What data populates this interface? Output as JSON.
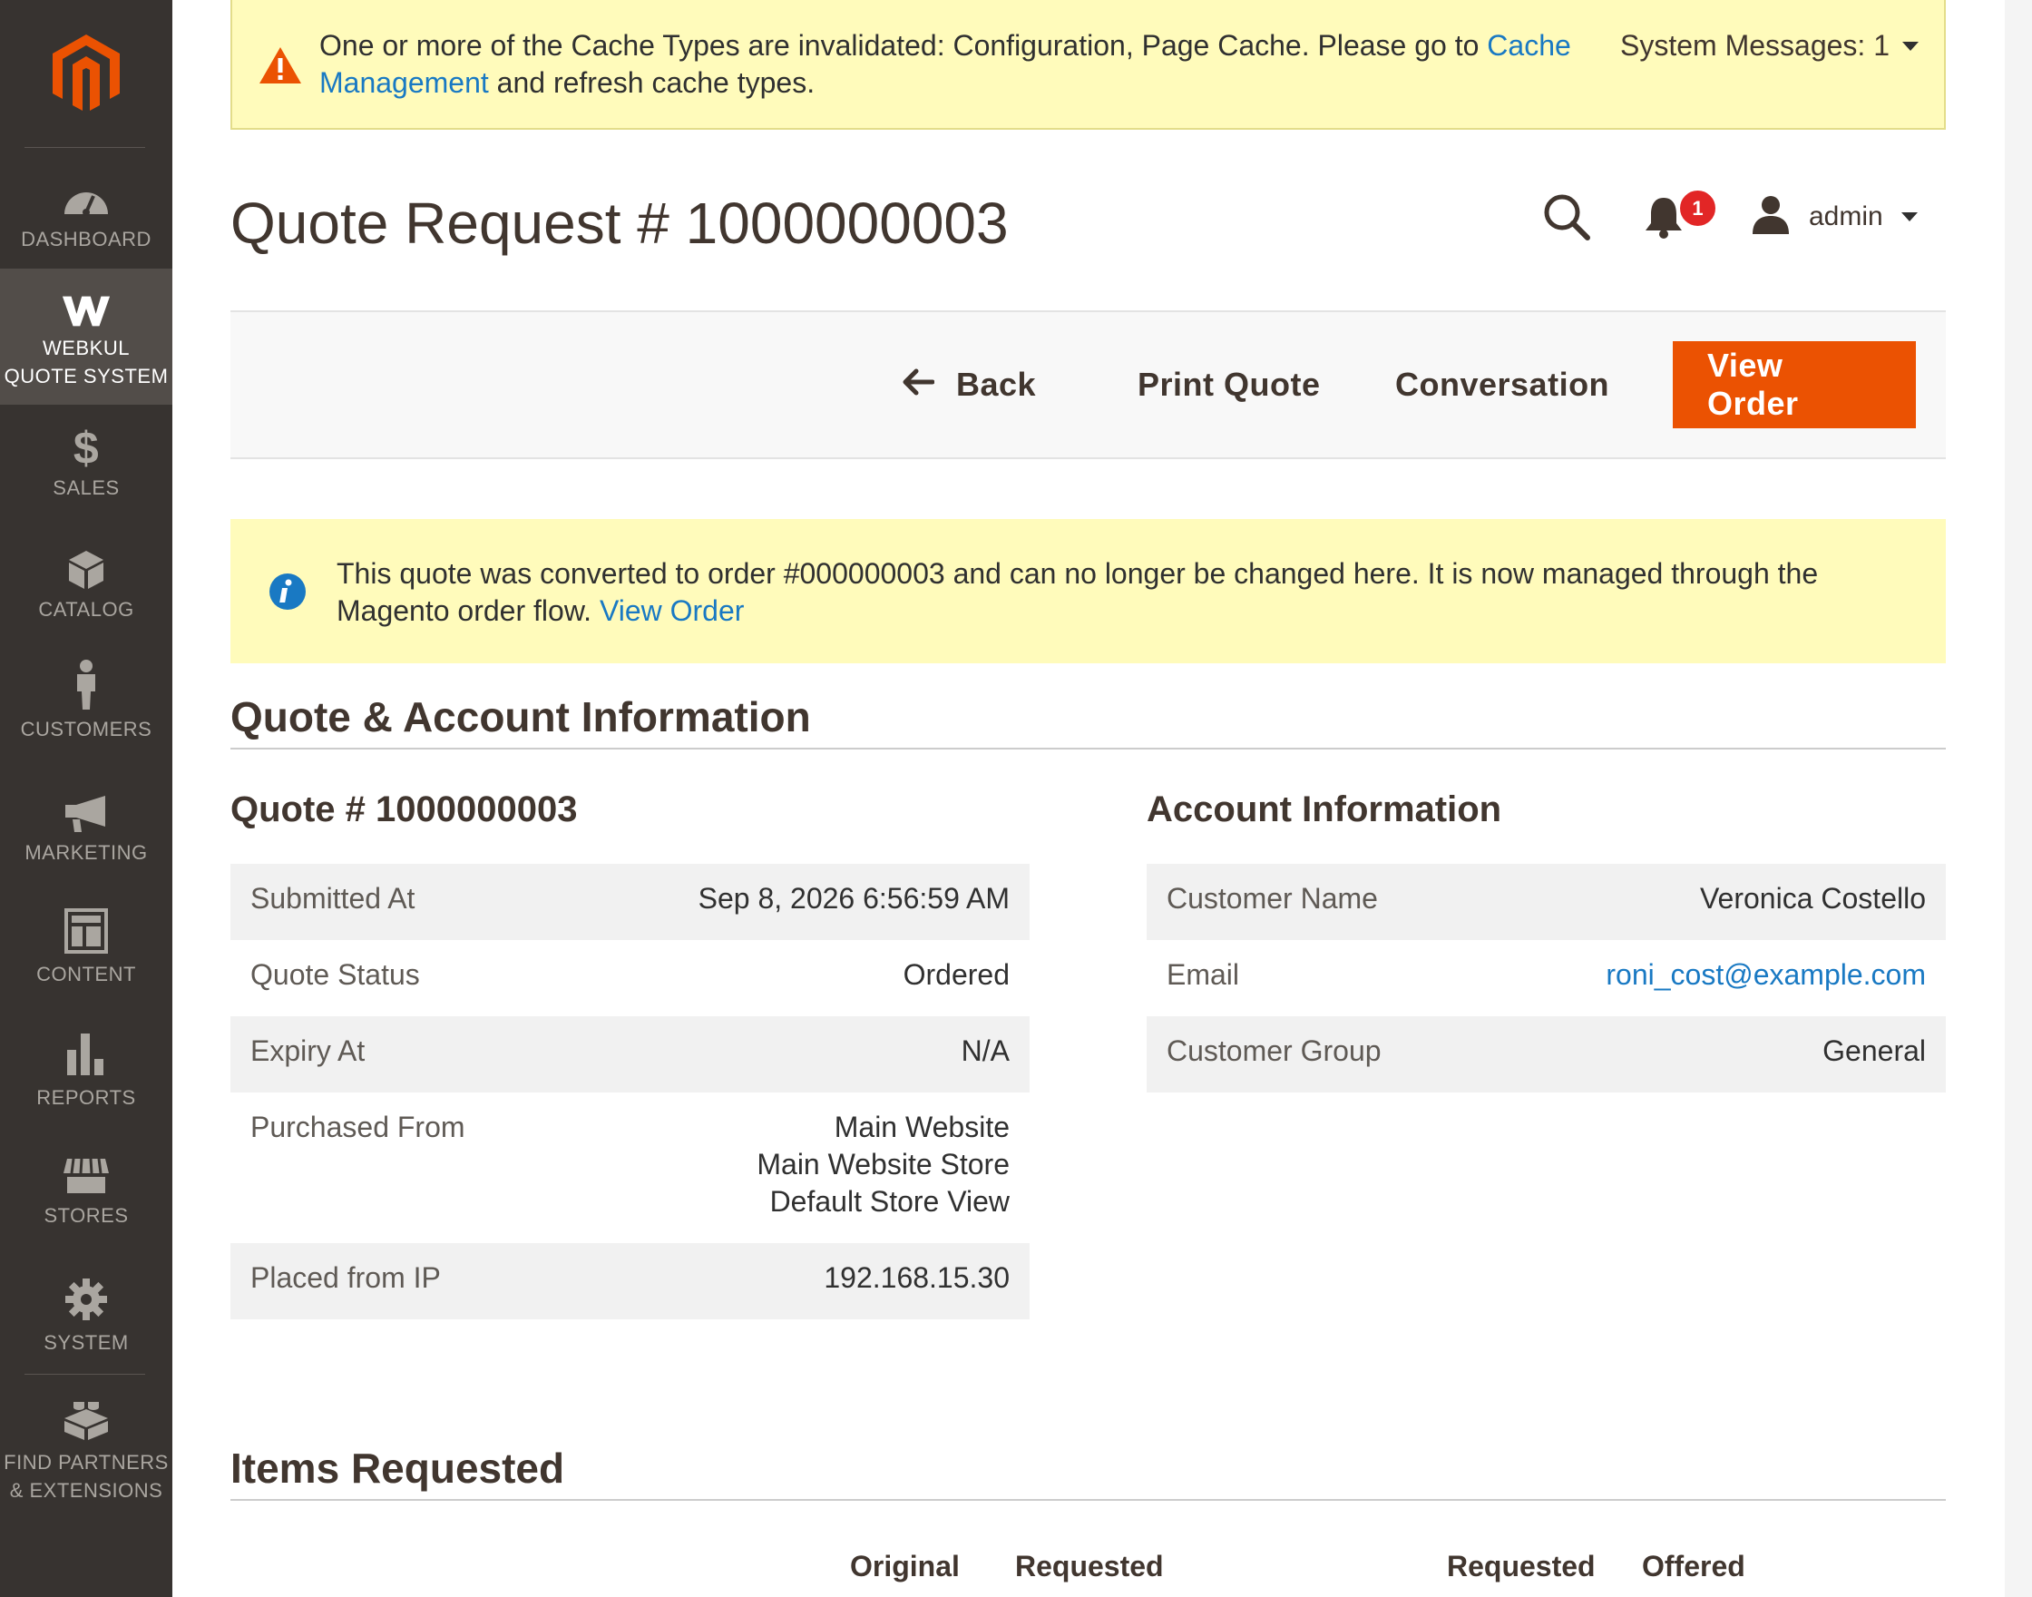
{
  "sidebar": {
    "items": [
      {
        "label": "DASHBOARD",
        "icon": "dashboard-icon"
      },
      {
        "label": "WEBKUL\nQUOTE SYSTEM",
        "icon": "webkul-icon",
        "active": true
      },
      {
        "label": "SALES",
        "icon": "dollar-icon"
      },
      {
        "label": "CATALOG",
        "icon": "catalog-box-icon"
      },
      {
        "label": "CUSTOMERS",
        "icon": "customer-person-icon"
      },
      {
        "label": "MARKETING",
        "icon": "megaphone-icon"
      },
      {
        "label": "CONTENT",
        "icon": "content-layout-icon"
      },
      {
        "label": "REPORTS",
        "icon": "bar-chart-icon"
      },
      {
        "label": "STORES",
        "icon": "storefront-icon"
      },
      {
        "label": "SYSTEM",
        "icon": "gear-icon"
      },
      {
        "label": "FIND PARTNERS\n& EXTENSIONS",
        "icon": "lego-brick-icon"
      }
    ]
  },
  "system_message": {
    "text_before": "One or more of the Cache Types are invalidated: Configuration, Page Cache. Please go to ",
    "link": "Cache Management",
    "text_after": " and refresh cache types.",
    "count_label": "System Messages: 1"
  },
  "header": {
    "title": "Quote Request # 1000000003",
    "notification_count": "1",
    "user": "admin"
  },
  "actions": {
    "back": "Back",
    "print": "Print Quote",
    "conversation": "Conversation",
    "view_order": "View Order"
  },
  "notice": {
    "text": "This quote was converted to order #000000003 and can no longer be changed here. It is now managed through the Magento order flow. ",
    "link": "View Order"
  },
  "section": {
    "title": "Quote & Account Information"
  },
  "quote_info": {
    "title": "Quote # 1000000003",
    "rows": [
      {
        "label": "Submitted At",
        "value": "Sep 8, 2026 6:56:59 AM"
      },
      {
        "label": "Quote Status",
        "value": "Ordered"
      },
      {
        "label": "Expiry At",
        "value": "N/A"
      },
      {
        "label": "Purchased From",
        "value": "Main Website\nMain Website Store\nDefault Store View"
      },
      {
        "label": "Placed from IP",
        "value": "192.168.15.30"
      }
    ]
  },
  "account_info": {
    "title": "Account Information",
    "rows": [
      {
        "label": "Customer Name",
        "value": "Veronica Costello"
      },
      {
        "label": "Email",
        "value": "roni_cost@example.com",
        "link": true
      },
      {
        "label": "Customer Group",
        "value": "General"
      }
    ]
  },
  "items": {
    "title": "Items Requested",
    "columns": [
      "Original",
      "Requested",
      "Requested",
      "Offered"
    ]
  },
  "colors": {
    "accent": "#eb5202",
    "sidebar": "#373330",
    "notice_bg": "#fffbbb",
    "link": "#1979c3"
  }
}
